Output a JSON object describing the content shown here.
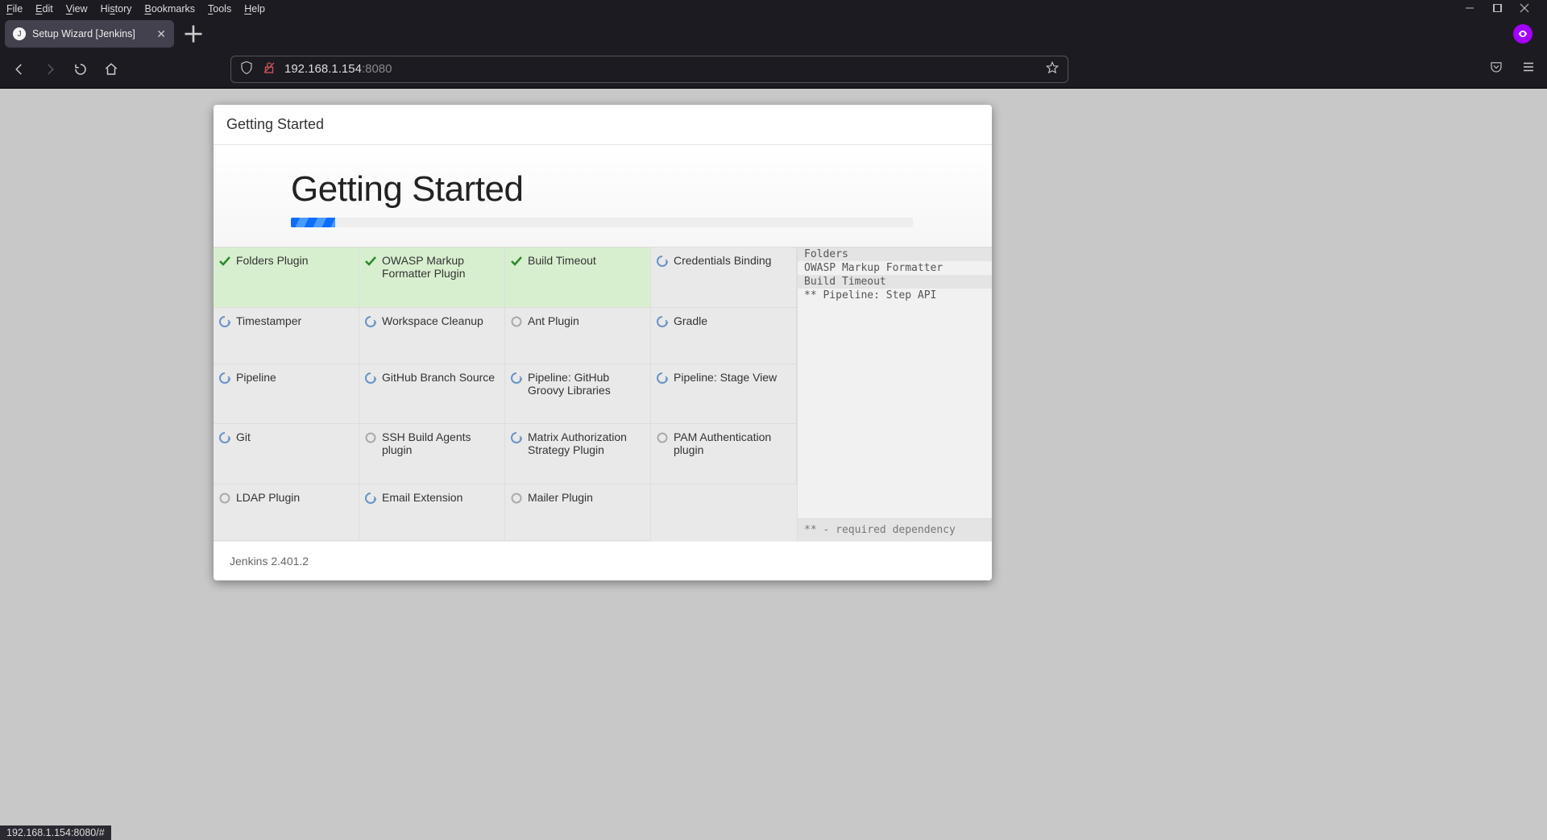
{
  "menu": [
    "File",
    "Edit",
    "View",
    "History",
    "Bookmarks",
    "Tools",
    "Help"
  ],
  "tab": {
    "title": "Setup Wizard [Jenkins]"
  },
  "url": {
    "host": "192.168.1.154",
    "port": ":8080"
  },
  "dialog": {
    "header": "Getting Started",
    "title": "Getting Started",
    "footer": "Jenkins 2.401.2"
  },
  "plugins": [
    {
      "name": "Folders Plugin",
      "state": "done"
    },
    {
      "name": "OWASP Markup Formatter Plugin",
      "state": "done"
    },
    {
      "name": "Build Timeout",
      "state": "done"
    },
    {
      "name": "Credentials Binding",
      "state": "spin"
    },
    {
      "name": "Timestamper",
      "state": "spin"
    },
    {
      "name": "Workspace Cleanup",
      "state": "spin"
    },
    {
      "name": "Ant Plugin",
      "state": "pend"
    },
    {
      "name": "Gradle",
      "state": "spin"
    },
    {
      "name": "Pipeline",
      "state": "spin"
    },
    {
      "name": "GitHub Branch Source",
      "state": "spin"
    },
    {
      "name": "Pipeline: GitHub Groovy Libraries",
      "state": "spin"
    },
    {
      "name": "Pipeline: Stage View",
      "state": "spin"
    },
    {
      "name": "Git",
      "state": "spin"
    },
    {
      "name": "SSH Build Agents plugin",
      "state": "pend"
    },
    {
      "name": "Matrix Authorization Strategy Plugin",
      "state": "spin"
    },
    {
      "name": "PAM Authentication plugin",
      "state": "pend"
    },
    {
      "name": "LDAP Plugin",
      "state": "pend"
    },
    {
      "name": "Email Extension",
      "state": "spin"
    },
    {
      "name": "Mailer Plugin",
      "state": "pend"
    },
    {
      "name": "",
      "state": "empty"
    }
  ],
  "log": {
    "lines": [
      {
        "text": "Folders",
        "alt": true
      },
      {
        "text": "OWASP Markup Formatter",
        "alt": false
      },
      {
        "text": "Build Timeout",
        "alt": true
      },
      {
        "text": "** Pipeline: Step API",
        "alt": false
      }
    ],
    "footnote": "** - required dependency"
  },
  "status": "192.168.1.154:8080/#"
}
